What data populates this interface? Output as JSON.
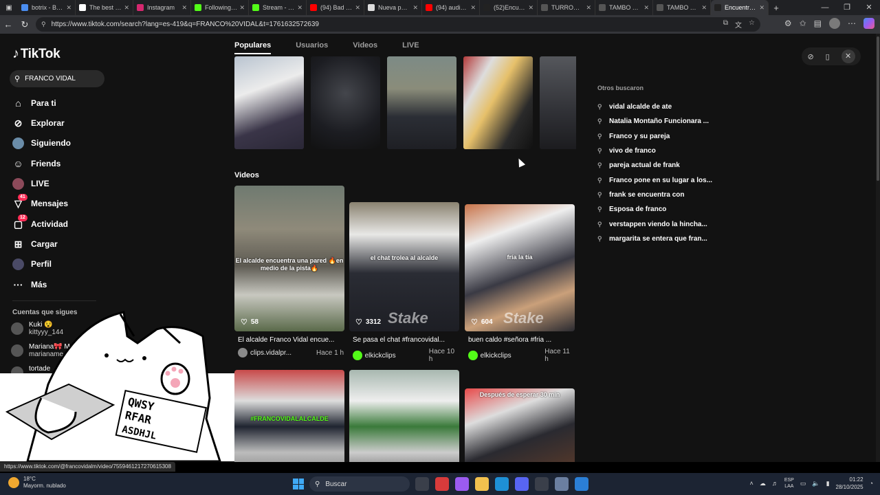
{
  "browser": {
    "tabs": [
      {
        "label": "botrix - Búsq",
        "color": "#4a8df0"
      },
      {
        "label": "The best Ch",
        "color": "#ffffff"
      },
      {
        "label": "Instagram",
        "color": "#d6286f"
      },
      {
        "label": "Following - K",
        "color": "#53fc18"
      },
      {
        "label": "Stream - Kic",
        "color": "#53fc18"
      },
      {
        "label": "(94) Bad Bun",
        "color": "#ff0000"
      },
      {
        "label": "Nueva pesta",
        "color": "#dddddd"
      },
      {
        "label": "(94) audio F",
        "color": "#ff0000"
      },
      {
        "label": "(52)Encuent",
        "color": "#222222"
      },
      {
        "label": "TURRON SL",
        "color": "#555555"
      },
      {
        "label": "TAMBO TUR",
        "color": "#555555"
      },
      {
        "label": "TAMBO TUR",
        "color": "#555555"
      },
      {
        "label": "Encuentra \"F",
        "color": "#222222"
      }
    ],
    "active_tab_index": 12,
    "url": "https://www.tiktok.com/search?lang=es-419&q=FRANCO%20VIDAL&t=1761632572639",
    "status_url": "https://www.tiktok.com/@francovidalm/video/7559461217270615308"
  },
  "sidebar": {
    "logo": "TikTok",
    "search_value": "FRANCO VIDAL",
    "nav": [
      {
        "label": "Para ti",
        "icon": "home-icon",
        "glyph": "⌂",
        "badge": ""
      },
      {
        "label": "Explorar",
        "icon": "compass-icon",
        "glyph": "⊘",
        "badge": ""
      },
      {
        "label": "Siguiendo",
        "icon": "following-avatar-icon",
        "glyph": "",
        "badge": ""
      },
      {
        "label": "Friends",
        "icon": "friends-icon",
        "glyph": "☺",
        "badge": ""
      },
      {
        "label": "LIVE",
        "icon": "live-avatar-icon",
        "glyph": "",
        "badge": ""
      },
      {
        "label": "Mensajes",
        "icon": "messages-icon",
        "glyph": "▽",
        "badge": "41"
      },
      {
        "label": "Actividad",
        "icon": "activity-icon",
        "glyph": "▢",
        "badge": "12"
      },
      {
        "label": "Cargar",
        "icon": "upload-icon",
        "glyph": "⊞",
        "badge": ""
      },
      {
        "label": "Perfil",
        "icon": "profile-avatar-icon",
        "glyph": "",
        "badge": ""
      },
      {
        "label": "Más",
        "icon": "more-icon",
        "glyph": "···",
        "badge": ""
      }
    ],
    "following_title": "Cuentas que sigues",
    "accounts": [
      {
        "name": "Kuki 😵",
        "handle": "kittyyy_144"
      },
      {
        "name": "Mariana🎀 M",
        "handle": "marianame"
      },
      {
        "name": "tortade",
        "handle": ""
      }
    ]
  },
  "main": {
    "tabs": [
      "Populares",
      "Usuarios",
      "Videos",
      "LIVE"
    ],
    "active_tab": "Populares",
    "videos_title": "Videos",
    "videos": [
      {
        "caption": "El alcalde encuentra una pared 🔥en medio de la pista🔥",
        "likes": "58",
        "title": "El alcalde Franco Vidal encue...",
        "user": "clips.vidalpr...",
        "when": "Hace 1 h",
        "stake": false
      },
      {
        "caption": "el chat trolea al alcalde",
        "likes": "3312",
        "title": "Se pasa el chat #francovidal...",
        "user": "elkickclips",
        "when": "Hace 10 h",
        "stake": true
      },
      {
        "caption": "fría la tía",
        "likes": "604",
        "title": "buen caldo #señora #fria ...",
        "user": "elkickclips",
        "when": "Hace 11 h",
        "stake": true
      },
      {
        "caption": "#FRANCOVIDALALCALDE",
        "likes": "",
        "title": "",
        "user": "",
        "when": "",
        "stake": false
      },
      {
        "caption": "",
        "likes": "",
        "title": "",
        "user": "",
        "when": "",
        "stake": false
      },
      {
        "caption": "Después de esperar 30 min",
        "likes": "",
        "title": "",
        "user": "",
        "when": "",
        "stake": false
      }
    ]
  },
  "related": {
    "title": "Otros buscaron",
    "items": [
      "vidal alcalde de ate",
      "Natalia Montaño Funcionara ...",
      "Franco y su pareja",
      "vivo de franco",
      "pareja actual de frank",
      "Franco pone en su lugar a los...",
      "frank se encuentra con",
      "Esposa de franco",
      "verstappen viendo la hincha...",
      "margarita se entera que fran..."
    ]
  },
  "overlay": {
    "keyboard_letters": "QWSY RFAR ASDHJL"
  },
  "taskbar": {
    "weather_temp": "18°C",
    "weather_desc": "Mayorm. nublado",
    "search_placeholder": "Buscar",
    "lang": "ESP",
    "lang2": "LAA",
    "time": "01:22",
    "date": "28/10/2025"
  },
  "colors": {
    "accent": "#fe2c55",
    "kick_green": "#53fc18"
  }
}
